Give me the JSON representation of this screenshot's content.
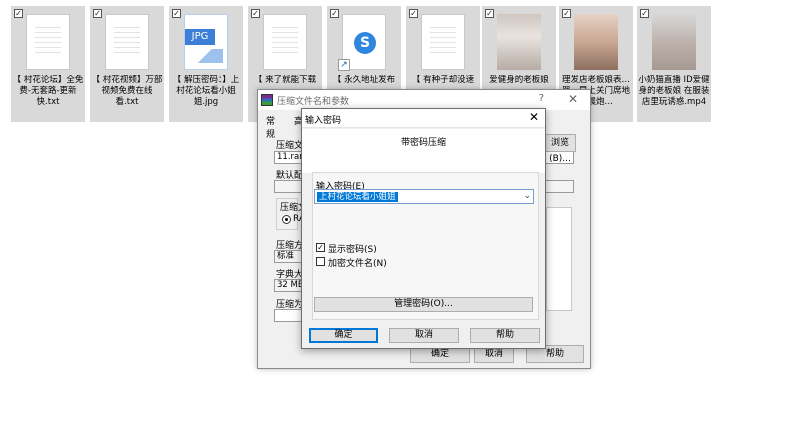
{
  "desktop": {
    "files": [
      {
        "label": "【 村花论坛】全免费-无套路-更新快.txt",
        "icon": "text-file-icon",
        "checked": true
      },
      {
        "label": "【 村花视频】万部视频免费在线看.txt",
        "icon": "text-file-icon",
        "checked": true
      },
      {
        "label": "【 解压密码：】上村花论坛看小姐姐.jpg",
        "icon": "jpg-file-icon",
        "badge": "JPG",
        "checked": true
      },
      {
        "label": "【 来了就能下载",
        "icon": "text-file-icon",
        "checked": true
      },
      {
        "label": "【 永久地址发布",
        "icon": "shortcut-file-icon",
        "checked": true
      },
      {
        "label": "【 有种子却没速",
        "icon": "text-file-icon",
        "checked": true
      },
      {
        "label": "爱健身的老板娘",
        "icon": "photo-thumbnail-icon",
        "checked": true
      },
      {
        "label": "理发店老板娘表…器一早上关门席地个晨炮…",
        "icon": "photo-thumbnail-icon",
        "checked": true
      },
      {
        "label": "小奶猫直播 ID爱健身的老板娘 在服装店里玩诱惑.mp4",
        "icon": "video-thumbnail-icon",
        "checked": true
      }
    ]
  },
  "archive_dialog": {
    "title": "压缩文件名和参数",
    "help": "?",
    "close": "✕",
    "tabs": [
      "常规",
      "高"
    ],
    "labels": {
      "archive_name": "压缩文",
      "default_profile": "默认配",
      "format_group": "压缩文",
      "format_radio": "RA",
      "method": "压缩方",
      "dict_size": "字典大",
      "split": "压缩为"
    },
    "values": {
      "archive_name": "11.rar",
      "method": "标准",
      "dict_size": "32 MB"
    },
    "browse": "浏览(B)...",
    "ok": "确定",
    "cancel": "取消",
    "help_btn": "帮助"
  },
  "password_dialog": {
    "title": "输入密码",
    "close": "✕",
    "heading": "带密码压缩",
    "password_label": "输入密码(E)",
    "password_value": "上村花论坛看小姐姐",
    "show_password": {
      "label": "显示密码(S)",
      "checked": true
    },
    "encrypt_names": {
      "label": "加密文件名(N)",
      "checked": false
    },
    "organize": "管理密码(O)...",
    "ok": "确定",
    "cancel": "取消",
    "help": "帮助"
  },
  "glyphs": {
    "check": "✓",
    "dropdown": "⌄"
  }
}
